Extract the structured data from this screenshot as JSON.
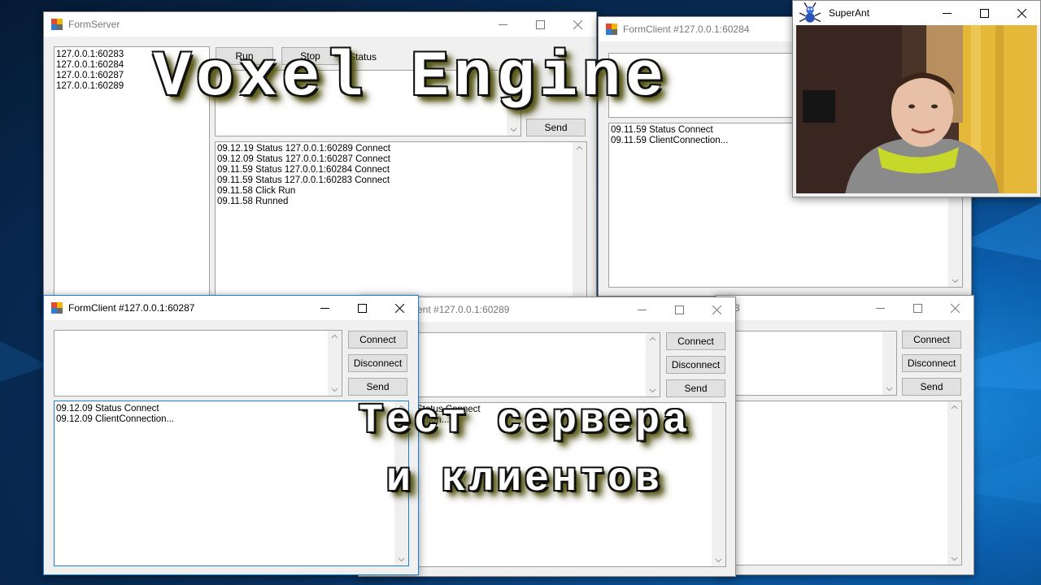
{
  "form_server": {
    "title": "FormServer",
    "clients": [
      "127.0.0.1:60283",
      "127.0.0.1:60284",
      "127.0.0.1:60287",
      "127.0.0.1:60289"
    ],
    "run_label": "Run",
    "stop_label": "Stop",
    "status_label": "Status",
    "send_label": "Send",
    "log": [
      "09.12.19 Status 127.0.0.1:60289 Connect",
      "09.12.09 Status 127.0.0.1:60287 Connect",
      "09.11.59 Status 127.0.0.1:60284 Connect",
      "09.11.59 Status 127.0.0.1:60283 Connect",
      "09.11.58 Click Run",
      "09.11.58 Runned"
    ]
  },
  "client_60284": {
    "title": "FormClient #127.0.0.1:60284",
    "log": [
      "09.11.59 Status Connect",
      "09.11.59 ClientConnection..."
    ]
  },
  "client_60287": {
    "title": "FormClient #127.0.0.1:60287",
    "connect_label": "Connect",
    "disconnect_label": "Disconnect",
    "send_label": "Send",
    "log": [
      "09.12.09 Status Connect",
      "09.12.09 ClientConnection..."
    ]
  },
  "client_60289": {
    "title_partial": "ent #127.0.0.1:60289",
    "connect_label": "Connect",
    "disconnect_label": "Disconnect",
    "send_label": "Send",
    "log_partial": [
      "Status Connect",
      "ection..."
    ]
  },
  "client_60283": {
    "title_partial": "3",
    "connect_label": "Connect",
    "disconnect_label": "Disconnect",
    "send_label": "Send"
  },
  "webcam": {
    "title": "SuperAnt"
  },
  "overlay": {
    "title": "Voxel Engine",
    "subtitle_line1": "Тест сервера",
    "subtitle_line2": "и клиентов"
  },
  "colors": {
    "active_border": "#1a7fd6",
    "desktop": "#0b5fae"
  },
  "icons": [
    "app-icon",
    "minimize-icon",
    "maximize-icon",
    "close-icon",
    "scroll-up-icon",
    "scroll-down-icon",
    "ant-icon"
  ]
}
